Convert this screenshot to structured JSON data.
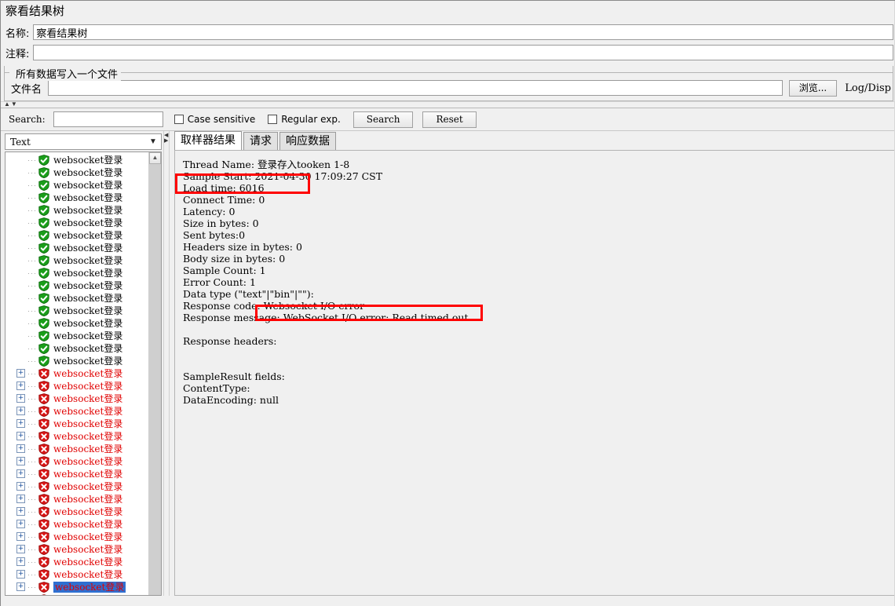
{
  "window": {
    "title": "察看结果树"
  },
  "form": {
    "name_label": "名称:",
    "name_value": "察看结果树",
    "comment_label": "注释:",
    "comment_value": ""
  },
  "file_group": {
    "title": "所有数据写入一个文件",
    "filename_label": "文件名",
    "filename_value": "",
    "browse_button": "浏览...",
    "log_display": "Log/Disp"
  },
  "search": {
    "label": "Search:",
    "value": "",
    "case_sensitive_label": "Case sensitive",
    "case_sensitive_checked": false,
    "regular_exp_label": "Regular exp.",
    "regular_exp_checked": false,
    "search_button": "Search",
    "reset_button": "Reset"
  },
  "left_panel": {
    "renderer_selected": "Text",
    "tree_items": [
      {
        "label": "websocket登录",
        "status": "ok",
        "expandable": false,
        "selected": false
      },
      {
        "label": "websocket登录",
        "status": "ok",
        "expandable": false,
        "selected": false
      },
      {
        "label": "websocket登录",
        "status": "ok",
        "expandable": false,
        "selected": false
      },
      {
        "label": "websocket登录",
        "status": "ok",
        "expandable": false,
        "selected": false
      },
      {
        "label": "websocket登录",
        "status": "ok",
        "expandable": false,
        "selected": false
      },
      {
        "label": "websocket登录",
        "status": "ok",
        "expandable": false,
        "selected": false
      },
      {
        "label": "websocket登录",
        "status": "ok",
        "expandable": false,
        "selected": false
      },
      {
        "label": "websocket登录",
        "status": "ok",
        "expandable": false,
        "selected": false
      },
      {
        "label": "websocket登录",
        "status": "ok",
        "expandable": false,
        "selected": false
      },
      {
        "label": "websocket登录",
        "status": "ok",
        "expandable": false,
        "selected": false
      },
      {
        "label": "websocket登录",
        "status": "ok",
        "expandable": false,
        "selected": false
      },
      {
        "label": "websocket登录",
        "status": "ok",
        "expandable": false,
        "selected": false
      },
      {
        "label": "websocket登录",
        "status": "ok",
        "expandable": false,
        "selected": false
      },
      {
        "label": "websocket登录",
        "status": "ok",
        "expandable": false,
        "selected": false
      },
      {
        "label": "websocket登录",
        "status": "ok",
        "expandable": false,
        "selected": false
      },
      {
        "label": "websocket登录",
        "status": "ok",
        "expandable": false,
        "selected": false
      },
      {
        "label": "websocket登录",
        "status": "ok",
        "expandable": false,
        "selected": false
      },
      {
        "label": "websocket登录",
        "status": "error",
        "expandable": true,
        "selected": false
      },
      {
        "label": "websocket登录",
        "status": "error",
        "expandable": true,
        "selected": false
      },
      {
        "label": "websocket登录",
        "status": "error",
        "expandable": true,
        "selected": false
      },
      {
        "label": "websocket登录",
        "status": "error",
        "expandable": true,
        "selected": false
      },
      {
        "label": "websocket登录",
        "status": "error",
        "expandable": true,
        "selected": false
      },
      {
        "label": "websocket登录",
        "status": "error",
        "expandable": true,
        "selected": false
      },
      {
        "label": "websocket登录",
        "status": "error",
        "expandable": true,
        "selected": false
      },
      {
        "label": "websocket登录",
        "status": "error",
        "expandable": true,
        "selected": false
      },
      {
        "label": "websocket登录",
        "status": "error",
        "expandable": true,
        "selected": false
      },
      {
        "label": "websocket登录",
        "status": "error",
        "expandable": true,
        "selected": false
      },
      {
        "label": "websocket登录",
        "status": "error",
        "expandable": true,
        "selected": false
      },
      {
        "label": "websocket登录",
        "status": "error",
        "expandable": true,
        "selected": false
      },
      {
        "label": "websocket登录",
        "status": "error",
        "expandable": true,
        "selected": false
      },
      {
        "label": "websocket登录",
        "status": "error",
        "expandable": true,
        "selected": false
      },
      {
        "label": "websocket登录",
        "status": "error",
        "expandable": true,
        "selected": false
      },
      {
        "label": "websocket登录",
        "status": "error",
        "expandable": true,
        "selected": false
      },
      {
        "label": "websocket登录",
        "status": "error",
        "expandable": true,
        "selected": false
      },
      {
        "label": "websocket登录",
        "status": "error",
        "expandable": true,
        "selected": true
      },
      {
        "label": "websocket登录",
        "status": "error",
        "expandable": true,
        "selected": false
      }
    ]
  },
  "right_panel": {
    "tabs": [
      {
        "label": "取样器结果",
        "active": true
      },
      {
        "label": "请求",
        "active": false
      },
      {
        "label": "响应数据",
        "active": false
      }
    ],
    "result_lines": [
      "Thread Name: 登录存入tooken 1-8",
      "Sample Start: 2021-04-30 17:09:27 CST",
      "Load time: 6016",
      "Connect Time: 0",
      "Latency: 0",
      "Size in bytes: 0",
      "Sent bytes:0",
      "Headers size in bytes: 0",
      "Body size in bytes: 0",
      "Sample Count: 1",
      "Error Count: 1",
      "Data type (\"text\"|\"bin\"|\"\"):",
      "Response code: Websocket I/O error",
      "Response message: WebSocket I/O error: Read timed out",
      "",
      "Response headers:",
      "",
      "",
      "SampleResult fields:",
      "ContentType:",
      "DataEncoding: null"
    ]
  },
  "annotations": {
    "highlight_color": "#ff0000",
    "boxes": [
      {
        "target": "Load time: 6016"
      },
      {
        "target": "WebSocket I/O error: Read timed out"
      }
    ]
  },
  "icons": {
    "ok": "shield-check-icon",
    "error": "shield-error-icon",
    "expander": "plus-expander-icon",
    "caret": "chevron-down-icon"
  }
}
